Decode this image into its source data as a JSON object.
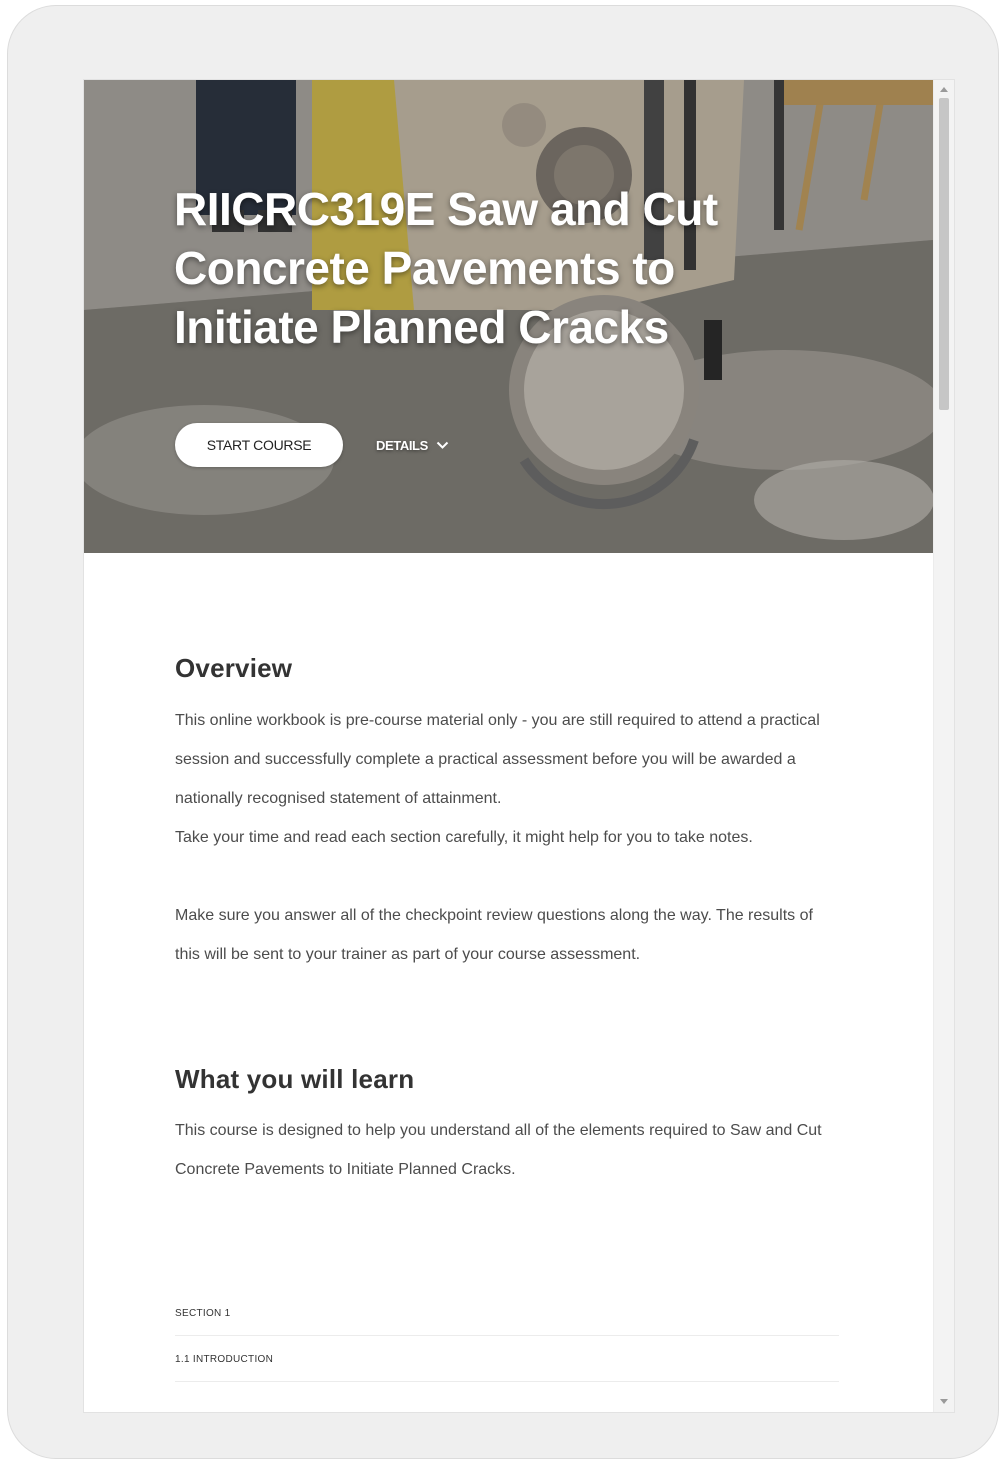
{
  "hero": {
    "title": "RIICRC319E Saw and Cut Concrete Pavements to Initiate Planned Cracks",
    "start_button": "START COURSE",
    "details_button": "DETAILS",
    "details_icon": "chevron-down-icon"
  },
  "overview": {
    "heading": "Overview",
    "paragraph_1": "This online workbook is pre-course material only - you are still required to attend a practical session and successfully complete a practical assessment before you will be awarded a nationally recognised statement of attainment.",
    "paragraph_2": "Take your time and read each section carefully, it might help for you to take notes.",
    "paragraph_3": "Make sure you answer all of the checkpoint review questions along the way. The results of this will be sent to your trainer as part of your course assessment."
  },
  "learn": {
    "heading": "What you will learn",
    "paragraph": "This course is designed to help you understand all of the elements required to Saw and Cut Concrete Pavements to Initiate Planned Cracks."
  },
  "outline": {
    "section_label": "SECTION 1",
    "lesson_label": "1.1 INTRODUCTION"
  },
  "colors": {
    "device_frame": "#efefef",
    "page_background": "#ffffff",
    "button_background": "#ffffff",
    "heading_text": "#333333",
    "body_text": "#4c4c4c"
  }
}
